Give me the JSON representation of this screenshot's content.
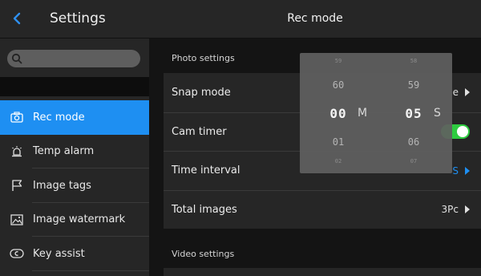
{
  "sidebar": {
    "title": "Settings",
    "search_placeholder": "",
    "items": [
      {
        "label": "Rec mode",
        "icon": "camera-icon",
        "active": true
      },
      {
        "label": "Temp alarm",
        "icon": "alarm-icon",
        "active": false
      },
      {
        "label": "Image tags",
        "icon": "flag-icon",
        "active": false
      },
      {
        "label": "Image watermark",
        "icon": "image-icon",
        "active": false
      },
      {
        "label": "Key assist",
        "icon": "key-icon",
        "active": false
      }
    ]
  },
  "main": {
    "title": "Rec mode",
    "photo_settings": {
      "label": "Photo settings",
      "rows": [
        {
          "label": "Snap mode",
          "value": "e"
        },
        {
          "label": "Cam timer",
          "toggle": true
        },
        {
          "label": "Time interval",
          "value": "S"
        },
        {
          "label": "Total images",
          "value": "3Pc"
        }
      ]
    },
    "video_settings": {
      "label": "Video settings"
    }
  },
  "picker": {
    "minutes": {
      "above_faint": "59",
      "above": "60",
      "selected": "00",
      "below": "01",
      "below_faint": "02",
      "unit": "M"
    },
    "seconds": {
      "above_faint": "58",
      "above": "59",
      "selected": "05",
      "below": "06",
      "below_faint": "07",
      "unit": "S"
    }
  },
  "colors": {
    "accent": "#1e8ff2",
    "toggle_on": "#2ecc40",
    "background": "#141414",
    "panel": "#262626"
  }
}
